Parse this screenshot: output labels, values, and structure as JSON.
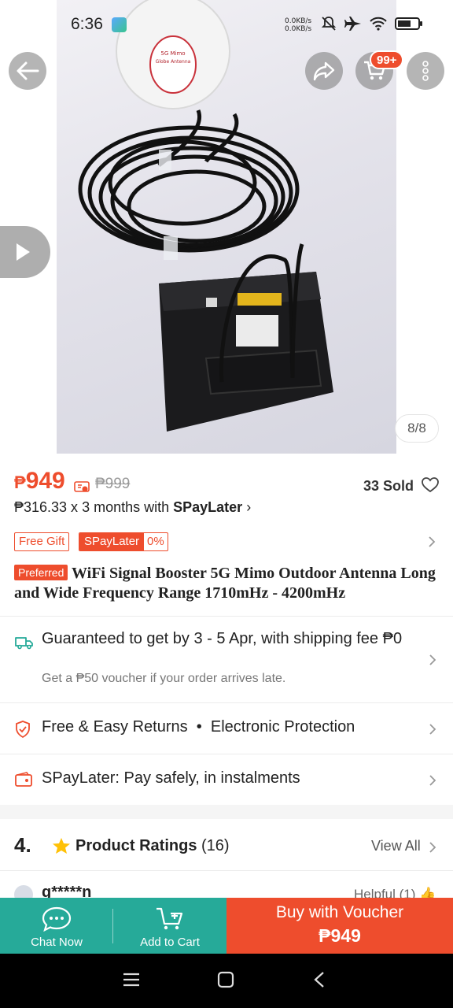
{
  "status_bar": {
    "time": "6:36",
    "net_up": "0.0KB/s",
    "net_down": "0.0KB/s"
  },
  "header": {
    "cart_badge": "99+"
  },
  "gallery": {
    "counter": "8/8",
    "antenna_label_lines": [
      "5G Mimo",
      "Globe Antenna"
    ]
  },
  "product": {
    "price_currency": "₱",
    "price_amount": "949",
    "original_price": "₱999",
    "sold": "33 Sold",
    "installment_amount": "₱316.33 x 3 months with",
    "installment_brand": "SPayLater",
    "tags": {
      "free_gift": "Free Gift",
      "spaylater": "SPayLater",
      "spaylater_rate": "0%"
    },
    "preferred_badge": "Preferred",
    "title": "WiFi Signal Booster 5G Mimo  Outdoor Antenna Long and Wide Frequency Range 1710mHz - 4200mHz"
  },
  "shipping": {
    "headline": "Guaranteed to get by 3 - 5 Apr, with shipping fee ₱0",
    "subline": "Get a ₱50 voucher if your order arrives late."
  },
  "protection": {
    "returns": "Free & Easy Returns",
    "bullet": "•",
    "electronic": "Electronic Protection"
  },
  "spaylater_row": {
    "text": "SPayLater: Pay safely, in instalments"
  },
  "ratings": {
    "score": "4.",
    "label": "Product Ratings",
    "count": "(16)",
    "view_all": "View All"
  },
  "review_peek": {
    "reviewer": "g*****n",
    "helpful": "Helpful (1)"
  },
  "actions": {
    "chat_now": "Chat Now",
    "add_to_cart": "Add to Cart",
    "buy_line1": "Buy with Voucher",
    "buy_line2": "₱949"
  },
  "colors": {
    "accent": "#ee4d2d",
    "teal": "#26aa99"
  }
}
